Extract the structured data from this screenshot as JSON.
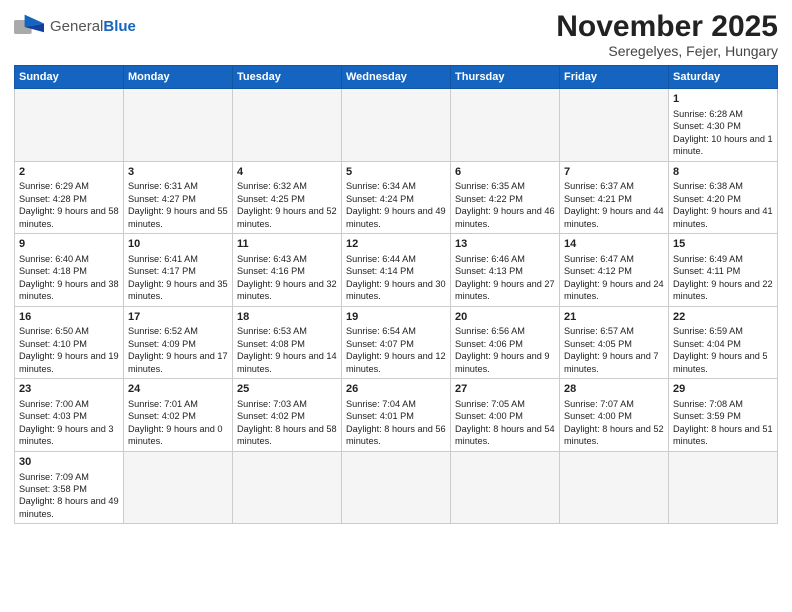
{
  "header": {
    "logo_general": "General",
    "logo_blue": "Blue",
    "title": "November 2025",
    "subtitle": "Seregelyes, Fejer, Hungary"
  },
  "weekdays": [
    "Sunday",
    "Monday",
    "Tuesday",
    "Wednesday",
    "Thursday",
    "Friday",
    "Saturday"
  ],
  "weeks": [
    [
      {
        "day": "",
        "info": ""
      },
      {
        "day": "",
        "info": ""
      },
      {
        "day": "",
        "info": ""
      },
      {
        "day": "",
        "info": ""
      },
      {
        "day": "",
        "info": ""
      },
      {
        "day": "",
        "info": ""
      },
      {
        "day": "1",
        "info": "Sunrise: 6:28 AM\nSunset: 4:30 PM\nDaylight: 10 hours\nand 1 minute."
      }
    ],
    [
      {
        "day": "2",
        "info": "Sunrise: 6:29 AM\nSunset: 4:28 PM\nDaylight: 9 hours\nand 58 minutes."
      },
      {
        "day": "3",
        "info": "Sunrise: 6:31 AM\nSunset: 4:27 PM\nDaylight: 9 hours\nand 55 minutes."
      },
      {
        "day": "4",
        "info": "Sunrise: 6:32 AM\nSunset: 4:25 PM\nDaylight: 9 hours\nand 52 minutes."
      },
      {
        "day": "5",
        "info": "Sunrise: 6:34 AM\nSunset: 4:24 PM\nDaylight: 9 hours\nand 49 minutes."
      },
      {
        "day": "6",
        "info": "Sunrise: 6:35 AM\nSunset: 4:22 PM\nDaylight: 9 hours\nand 46 minutes."
      },
      {
        "day": "7",
        "info": "Sunrise: 6:37 AM\nSunset: 4:21 PM\nDaylight: 9 hours\nand 44 minutes."
      },
      {
        "day": "8",
        "info": "Sunrise: 6:38 AM\nSunset: 4:20 PM\nDaylight: 9 hours\nand 41 minutes."
      }
    ],
    [
      {
        "day": "9",
        "info": "Sunrise: 6:40 AM\nSunset: 4:18 PM\nDaylight: 9 hours\nand 38 minutes."
      },
      {
        "day": "10",
        "info": "Sunrise: 6:41 AM\nSunset: 4:17 PM\nDaylight: 9 hours\nand 35 minutes."
      },
      {
        "day": "11",
        "info": "Sunrise: 6:43 AM\nSunset: 4:16 PM\nDaylight: 9 hours\nand 32 minutes."
      },
      {
        "day": "12",
        "info": "Sunrise: 6:44 AM\nSunset: 4:14 PM\nDaylight: 9 hours\nand 30 minutes."
      },
      {
        "day": "13",
        "info": "Sunrise: 6:46 AM\nSunset: 4:13 PM\nDaylight: 9 hours\nand 27 minutes."
      },
      {
        "day": "14",
        "info": "Sunrise: 6:47 AM\nSunset: 4:12 PM\nDaylight: 9 hours\nand 24 minutes."
      },
      {
        "day": "15",
        "info": "Sunrise: 6:49 AM\nSunset: 4:11 PM\nDaylight: 9 hours\nand 22 minutes."
      }
    ],
    [
      {
        "day": "16",
        "info": "Sunrise: 6:50 AM\nSunset: 4:10 PM\nDaylight: 9 hours\nand 19 minutes."
      },
      {
        "day": "17",
        "info": "Sunrise: 6:52 AM\nSunset: 4:09 PM\nDaylight: 9 hours\nand 17 minutes."
      },
      {
        "day": "18",
        "info": "Sunrise: 6:53 AM\nSunset: 4:08 PM\nDaylight: 9 hours\nand 14 minutes."
      },
      {
        "day": "19",
        "info": "Sunrise: 6:54 AM\nSunset: 4:07 PM\nDaylight: 9 hours\nand 12 minutes."
      },
      {
        "day": "20",
        "info": "Sunrise: 6:56 AM\nSunset: 4:06 PM\nDaylight: 9 hours\nand 9 minutes."
      },
      {
        "day": "21",
        "info": "Sunrise: 6:57 AM\nSunset: 4:05 PM\nDaylight: 9 hours\nand 7 minutes."
      },
      {
        "day": "22",
        "info": "Sunrise: 6:59 AM\nSunset: 4:04 PM\nDaylight: 9 hours\nand 5 minutes."
      }
    ],
    [
      {
        "day": "23",
        "info": "Sunrise: 7:00 AM\nSunset: 4:03 PM\nDaylight: 9 hours\nand 3 minutes."
      },
      {
        "day": "24",
        "info": "Sunrise: 7:01 AM\nSunset: 4:02 PM\nDaylight: 9 hours\nand 0 minutes."
      },
      {
        "day": "25",
        "info": "Sunrise: 7:03 AM\nSunset: 4:02 PM\nDaylight: 8 hours\nand 58 minutes."
      },
      {
        "day": "26",
        "info": "Sunrise: 7:04 AM\nSunset: 4:01 PM\nDaylight: 8 hours\nand 56 minutes."
      },
      {
        "day": "27",
        "info": "Sunrise: 7:05 AM\nSunset: 4:00 PM\nDaylight: 8 hours\nand 54 minutes."
      },
      {
        "day": "28",
        "info": "Sunrise: 7:07 AM\nSunset: 4:00 PM\nDaylight: 8 hours\nand 52 minutes."
      },
      {
        "day": "29",
        "info": "Sunrise: 7:08 AM\nSunset: 3:59 PM\nDaylight: 8 hours\nand 51 minutes."
      }
    ],
    [
      {
        "day": "30",
        "info": "Sunrise: 7:09 AM\nSunset: 3:58 PM\nDaylight: 8 hours\nand 49 minutes."
      },
      {
        "day": "",
        "info": ""
      },
      {
        "day": "",
        "info": ""
      },
      {
        "day": "",
        "info": ""
      },
      {
        "day": "",
        "info": ""
      },
      {
        "day": "",
        "info": ""
      },
      {
        "day": "",
        "info": ""
      }
    ]
  ]
}
